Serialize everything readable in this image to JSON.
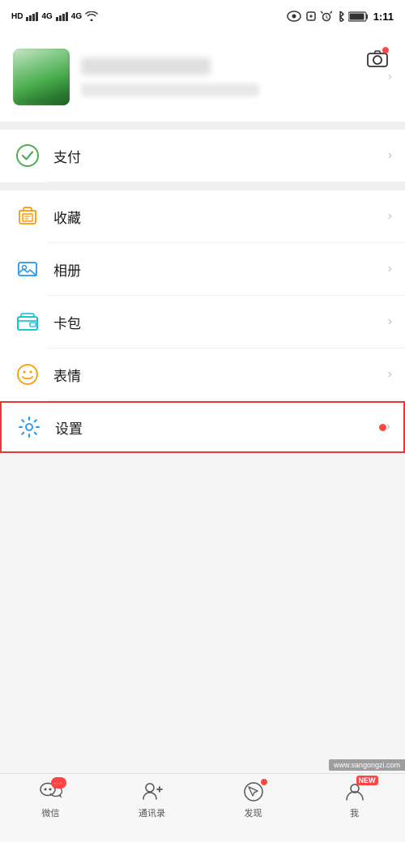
{
  "statusBar": {
    "network": "HD",
    "signal1": "4G",
    "signal2": "4G",
    "time": "1:11",
    "batteryIcon": "🔋"
  },
  "profile": {
    "cameraAlt": "camera",
    "nameBlur": true,
    "detailBlur": true
  },
  "menuItems": [
    {
      "id": "payment",
      "label": "支付",
      "iconType": "payment",
      "highlighted": false,
      "dot": false
    },
    {
      "id": "favorites",
      "label": "收藏",
      "iconType": "favorites",
      "highlighted": false,
      "dot": false
    },
    {
      "id": "album",
      "label": "相册",
      "iconType": "album",
      "highlighted": false,
      "dot": false
    },
    {
      "id": "wallet",
      "label": "卡包",
      "iconType": "wallet",
      "highlighted": false,
      "dot": false
    },
    {
      "id": "emoji",
      "label": "表情",
      "iconType": "emoji",
      "highlighted": false,
      "dot": false
    },
    {
      "id": "settings",
      "label": "设置",
      "iconType": "settings",
      "highlighted": true,
      "dot": true
    }
  ],
  "bottomNav": [
    {
      "id": "wechat",
      "label": "微信",
      "iconType": "chat",
      "badge": "···",
      "dot": false,
      "new": false
    },
    {
      "id": "contacts",
      "label": "通讯录",
      "iconType": "contacts",
      "badge": null,
      "dot": false,
      "new": false
    },
    {
      "id": "discover",
      "label": "发现",
      "iconType": "discover",
      "badge": null,
      "dot": true,
      "new": false
    },
    {
      "id": "me",
      "label": "我",
      "iconType": "me",
      "badge": null,
      "dot": false,
      "new": true
    }
  ],
  "watermark": {
    "text": "www.sangongzi.com"
  }
}
